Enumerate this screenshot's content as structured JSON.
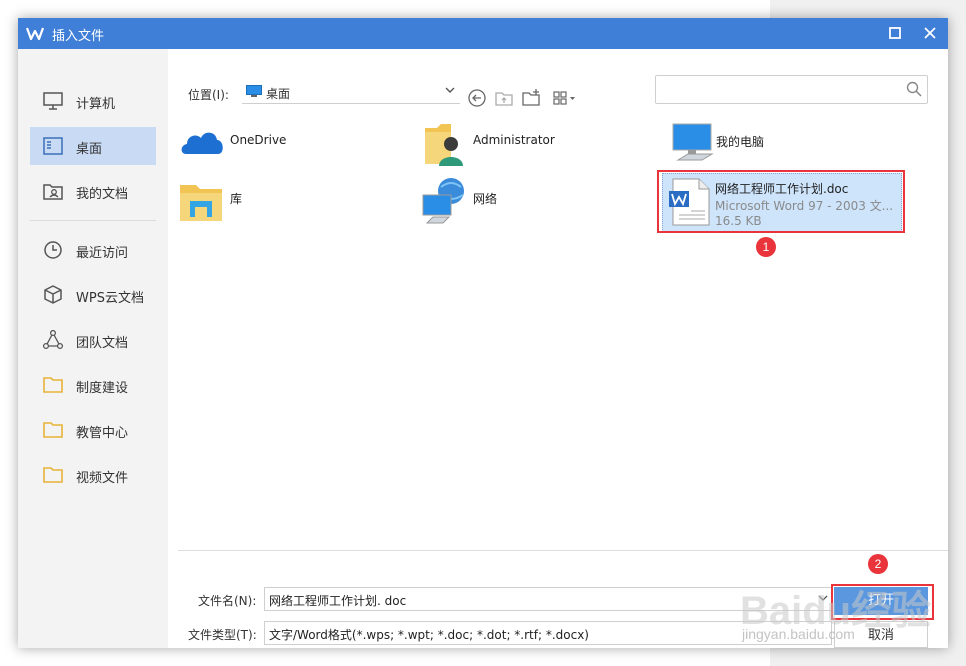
{
  "titlebar": {
    "title": "插入文件"
  },
  "sidebar": {
    "items": [
      {
        "label": "计算机",
        "icon": "monitor-icon"
      },
      {
        "label": "桌面",
        "icon": "desktop-icon",
        "selected": true
      },
      {
        "label": "我的文档",
        "icon": "documents-icon"
      },
      {
        "label": "最近访问",
        "icon": "clock-icon"
      },
      {
        "label": "WPS云文档",
        "icon": "cube-icon"
      },
      {
        "label": "团队文档",
        "icon": "team-icon"
      },
      {
        "label": "制度建设",
        "icon": "folder-icon"
      },
      {
        "label": "教管中心",
        "icon": "folder-icon"
      },
      {
        "label": "视频文件",
        "icon": "folder-icon"
      }
    ]
  },
  "location": {
    "label": "位置(I):",
    "value": "桌面"
  },
  "search": {
    "placeholder": ""
  },
  "files": [
    {
      "name": "OneDrive",
      "icon": "onedrive-icon"
    },
    {
      "name": "Administrator",
      "icon": "user-folder-icon"
    },
    {
      "name": "我的电脑",
      "icon": "computer-icon"
    },
    {
      "name": "库",
      "icon": "library-icon"
    },
    {
      "name": "网络",
      "icon": "network-icon"
    },
    {
      "name": "网络工程师工作计划.doc",
      "type": "Microsoft Word 97 - 2003 文...",
      "size": "16.5 KB",
      "icon": "word-doc-icon",
      "selected": true
    }
  ],
  "annotations": {
    "step1": "1",
    "step2": "2",
    "color": "#e8343a"
  },
  "form": {
    "filename_label": "文件名(N):",
    "filename_value": "网络工程师工作计划. doc",
    "filetype_label": "文件类型(T):",
    "filetype_value": "文字/Word格式(*.wps; *.wpt; *.doc; *.dot; *.rtf; *.docx)",
    "open_label": "打开",
    "cancel_label": "取消"
  },
  "watermark": {
    "brand": "Baidu经验",
    "url": "jingyan.baidu.com"
  },
  "colors": {
    "titlebar": "#3f7fd7",
    "selection": "#c9dbf4",
    "button": "#5a97df"
  }
}
